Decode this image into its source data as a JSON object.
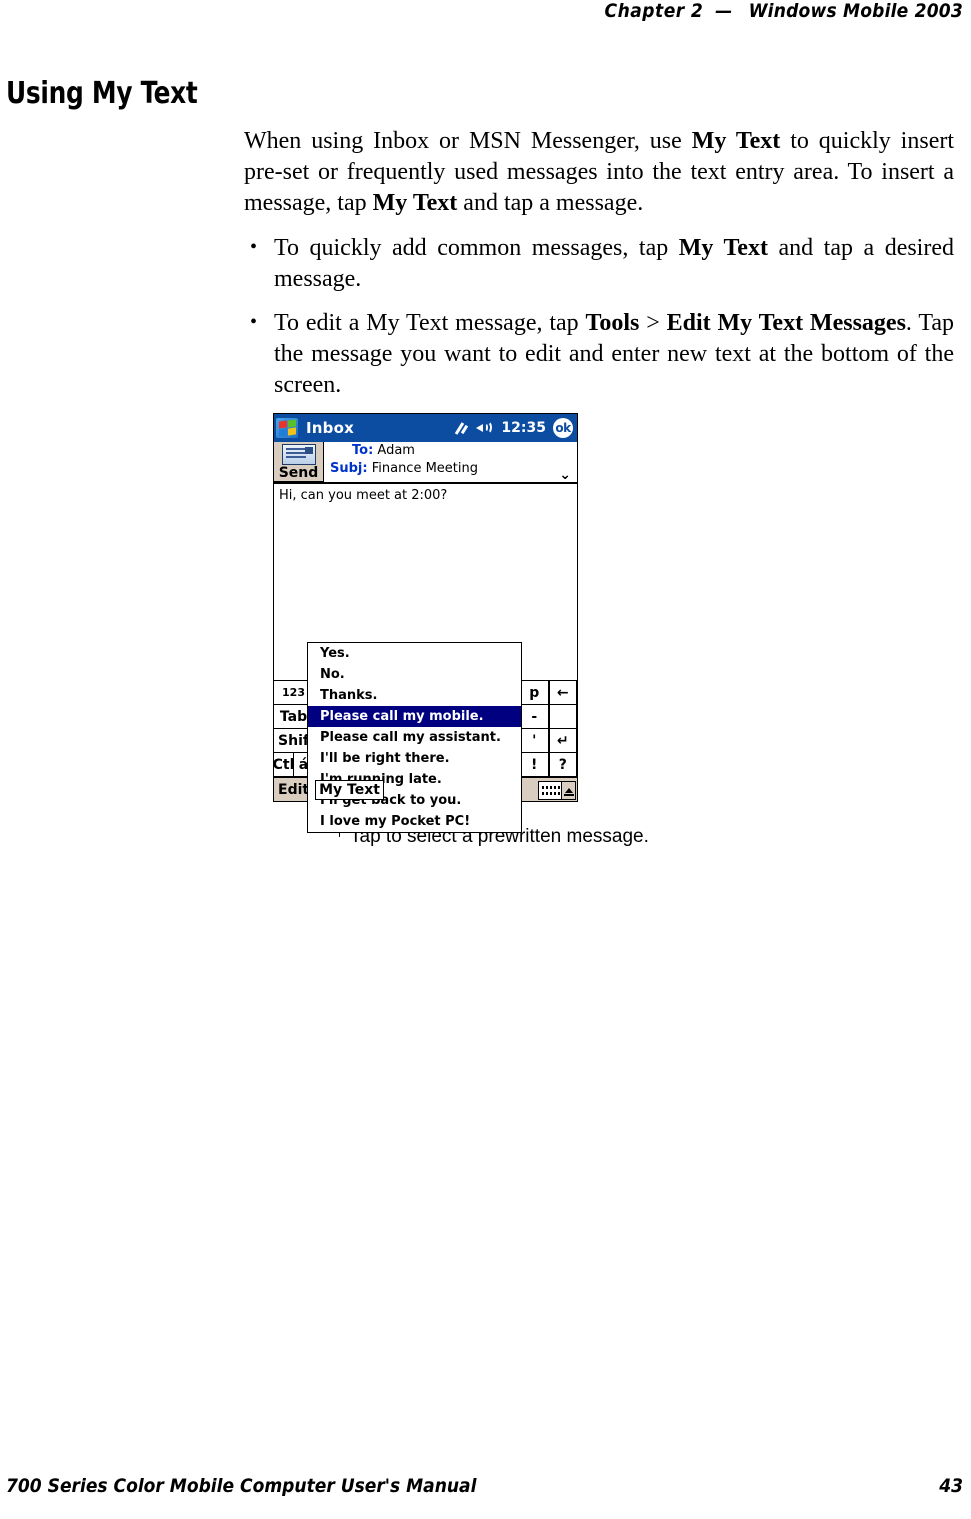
{
  "header": {
    "chapter_label": "Chapter",
    "chapter_number": "2",
    "dash": "—",
    "product": "Windows Mobile 2003"
  },
  "section": {
    "title": "Using My Text"
  },
  "body": {
    "intro_part1": "When using Inbox or MSN Messenger, use ",
    "intro_bold1": "My Text",
    "intro_part2": " to quickly insert pre-set or frequently used messages into the text entry area. To insert a message, tap ",
    "intro_bold2": "My Text",
    "intro_part3": " and tap a message.",
    "bullets": [
      {
        "part1": "To quickly add common messages, tap ",
        "bold1": "My Text",
        "part2": " and tap a desired message."
      },
      {
        "part1": "To edit a My Text message, tap ",
        "bold1": "Tools",
        "sep": " > ",
        "bold2": "Edit My Text Messages",
        "part2": ". Tap the message you want to edit and enter new text at the bottom of the screen."
      }
    ]
  },
  "figure": {
    "caption": "Tap to select a prewritten message.",
    "pda": {
      "titlebar": {
        "app_title": "Inbox",
        "clock": "12:35",
        "ok_label": "ok",
        "start_icon": "windows-flag-icon",
        "sync_icon": "sync-arrows-icon",
        "volume_icon": "speaker-icon",
        "bg_color": "#0C4DA2"
      },
      "toolbar": {
        "send_label": "Send",
        "send_icon": "envelope-icon"
      },
      "fields": {
        "to_label": "To:",
        "to_value": "Adam",
        "subject_label": "Subj:",
        "subject_value": "Finance Meeting",
        "expand_icon": "chevron-double-down-icon"
      },
      "message_body": "Hi, can you meet at 2:00?",
      "mytext_menu": {
        "items": [
          "Yes.",
          "No.",
          "Thanks.",
          "Please call my mobile.",
          "Please call my assistant.",
          "I'll be right there.",
          "I'm running late.",
          "I'll get back to you.",
          "I love my Pocket PC!"
        ],
        "selected_index": 3,
        "selected_color": "#000080"
      },
      "keyboard": {
        "left_keys": [
          "123",
          "Tab",
          "Shif",
          "Ctl",
          "á"
        ],
        "right_keys": [
          "p",
          "←",
          "-",
          "'",
          "↵",
          "!",
          "?"
        ]
      },
      "commandbar": {
        "edit_label": "Edit",
        "mytext_label": "My Text",
        "icon1": "note-list-icon",
        "icon2": "emoticon-icon",
        "keyboard_icon": "soft-keyboard-icon",
        "up_arrow_icon": "chevron-up-icon",
        "bg_color": "#d9cdc0"
      }
    }
  },
  "footer": {
    "manual_title": "700 Series Color Mobile Computer User's Manual",
    "page_number": "43"
  }
}
